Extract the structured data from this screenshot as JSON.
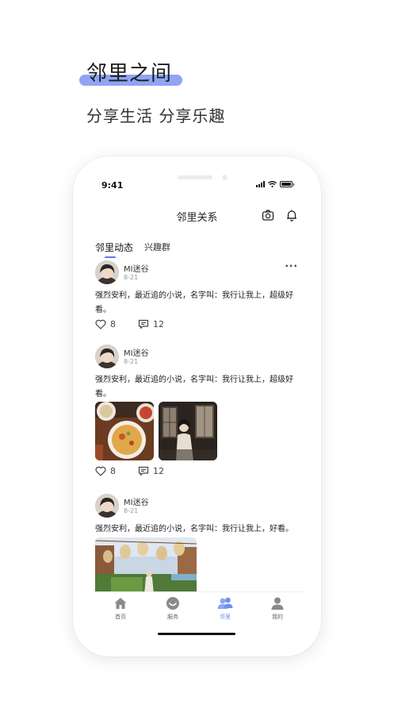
{
  "promo": {
    "title": "邻里之间",
    "subtitle": "分享生活 分享乐趣",
    "accent_color": "#8fa4f3"
  },
  "status_bar": {
    "time": "9:41",
    "icons": [
      "signal-icon",
      "wifi-icon",
      "battery-icon"
    ]
  },
  "nav": {
    "title": "邻里关系",
    "icons": [
      "camera-icon",
      "bell-icon"
    ]
  },
  "tabs": [
    {
      "label": "邻里动态",
      "active": true
    },
    {
      "label": "兴趣群",
      "active": false
    }
  ],
  "posts": [
    {
      "author": "MI迷谷",
      "date": "8-21",
      "text": "强烈安利，最近追的小说，名字叫：我行让我上，超级好看。",
      "likes": "8",
      "comments": "12",
      "more": "···",
      "images": []
    },
    {
      "author": "MI迷谷",
      "date": "8-21",
      "text": "强烈安利，最近追的小说，名字叫：我行让我上，超级好看。",
      "likes": "8",
      "comments": "12",
      "images": [
        "food-photo",
        "portrait-photo"
      ]
    },
    {
      "author": "MI迷谷",
      "date": "8-21",
      "text": "强烈安利，最近追的小说，名字叫：我行让我上，好看。",
      "images": [
        "lantern-garden-photo"
      ]
    }
  ],
  "tabbar": {
    "active_color": "#6f8ef0",
    "items": [
      {
        "label": "首页",
        "icon": "home-icon",
        "active": false
      },
      {
        "label": "服务",
        "icon": "smile-icon",
        "active": false
      },
      {
        "label": "邻里",
        "icon": "neighbors-icon",
        "active": true
      },
      {
        "label": "我的",
        "icon": "profile-icon",
        "active": false
      }
    ]
  }
}
